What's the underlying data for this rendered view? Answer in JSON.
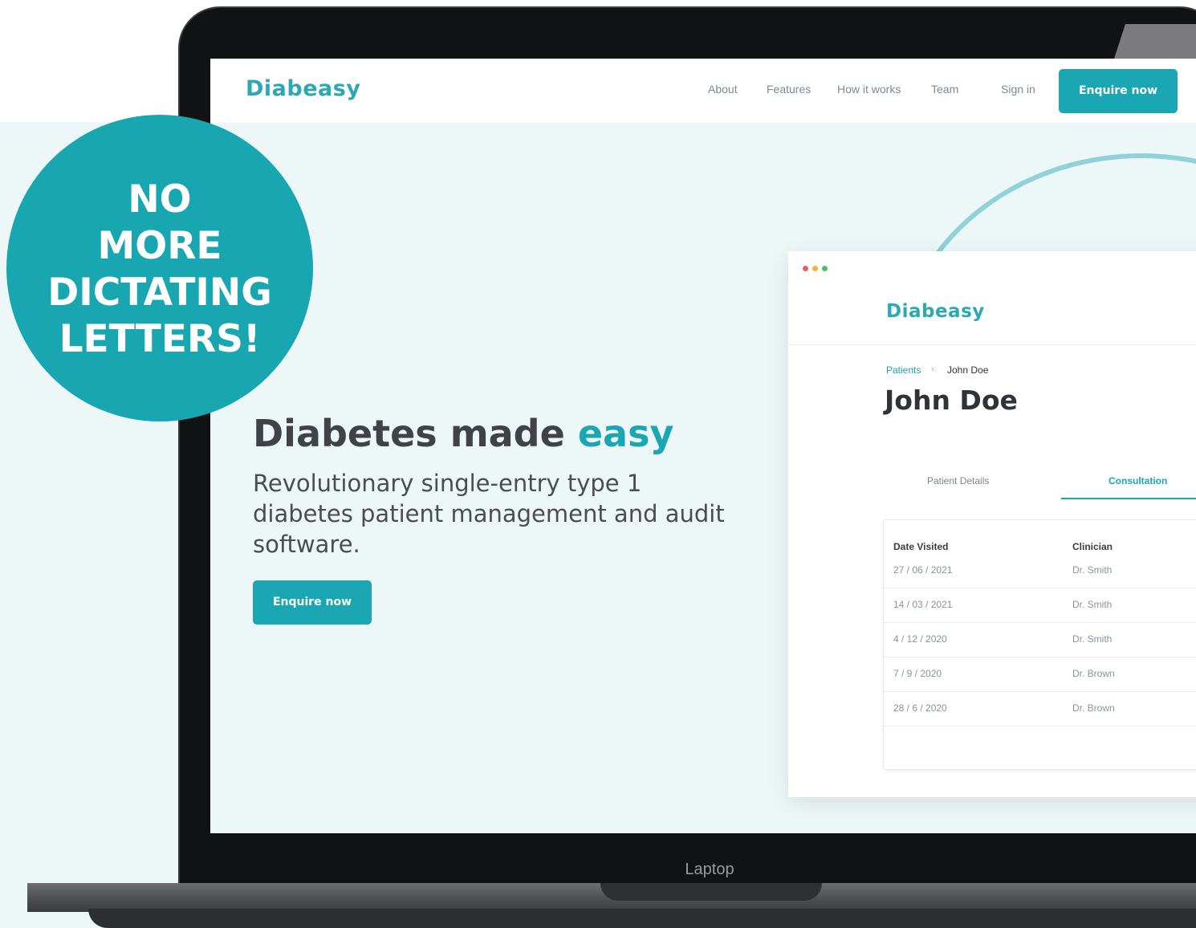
{
  "badge": {
    "lines": [
      "NO",
      "MORE",
      "DICTATING",
      "LETTERS!"
    ]
  },
  "device": {
    "label": "Laptop"
  },
  "site": {
    "logo": "Diabeasy",
    "nav": {
      "about": "About",
      "features": "Features",
      "how_it_works": "How it works",
      "team": "Team",
      "sign_in": "Sign in",
      "cta": "Enquire now"
    },
    "hero": {
      "title": "Diabetes made",
      "title_accent": "easy",
      "subtitle": "Revolutionary single-entry type 1 diabetes patient management and audit software.",
      "cta": "Enquire now"
    }
  },
  "app": {
    "logo": "Diabeasy",
    "window_dot_colors": [
      "#ee5b5b",
      "#f2b63c",
      "#4cc15e"
    ],
    "breadcrumb": {
      "parent": "Patients",
      "separator": "›",
      "current": "John Doe"
    },
    "patient_name": "John Doe",
    "tabs": {
      "details": "Patient Details",
      "consultation": "Consultation"
    },
    "table": {
      "headers": [
        "Date Visited",
        "Clinician"
      ],
      "rows": [
        [
          "27 / 06 / 2021",
          "Dr. Smith"
        ],
        [
          "14 / 03 / 2021",
          "Dr. Smith"
        ],
        [
          "4 / 12 / 2020",
          "Dr. Smith"
        ],
        [
          "7 / 9 / 2020",
          "Dr. Brown"
        ],
        [
          "28 / 6 / 2020",
          "Dr. Brown"
        ]
      ]
    }
  },
  "colors": {
    "accent": "#1aa6b2",
    "background": "#eef7f8",
    "badge": "#18a7b1"
  }
}
